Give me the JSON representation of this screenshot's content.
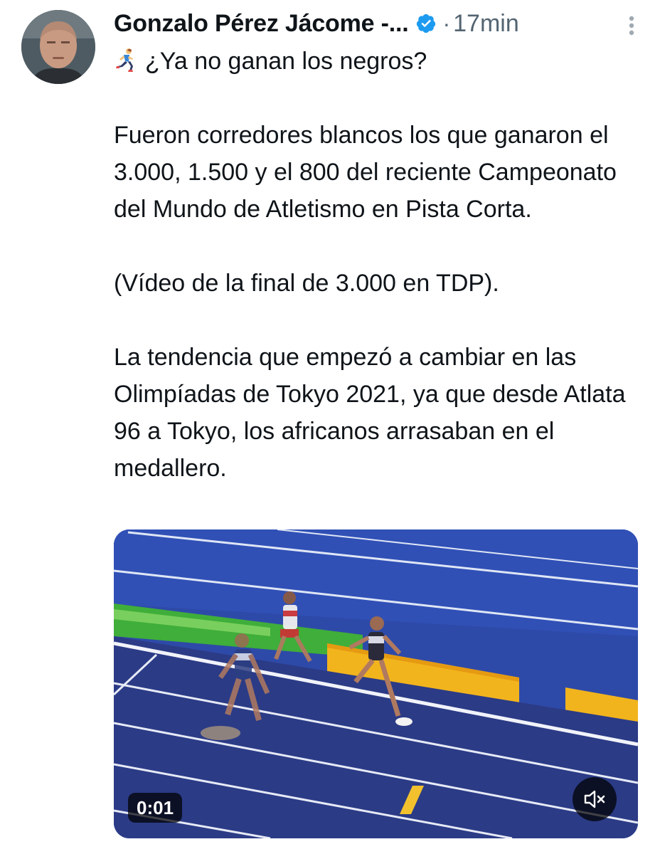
{
  "author": {
    "display_name": "Gonzalo Pérez Jácome -...",
    "verified": true,
    "avatar_icon": "profile-photo"
  },
  "meta": {
    "separator": "·",
    "timestamp": "17min"
  },
  "tweet": {
    "emoji_icon": "person-running-emoji",
    "lines": [
      "¿Ya no ganan los negros?",
      "Fueron corredores blancos los que ganaron el 3.000, 1.500 y el 800 del reciente Campeonato del Mundo de Atletismo en Pista Corta.",
      "(Vídeo de la final de 3.000 en TDP).",
      "La tendencia que empezó a cambiar en las Olimpíadas de Tokyo 2021, ya que desde Atlata 96 a Tokyo, los africanos arrasaban en el medallero."
    ]
  },
  "media": {
    "type": "video",
    "duration": "0:01",
    "muted": true
  },
  "colors": {
    "verified_badge": "#1d9bf0",
    "secondary_text": "#536471",
    "track_blue": "#2e4aa8",
    "infield_green": "#3fae3a",
    "banner_yellow": "#f2b41d"
  }
}
